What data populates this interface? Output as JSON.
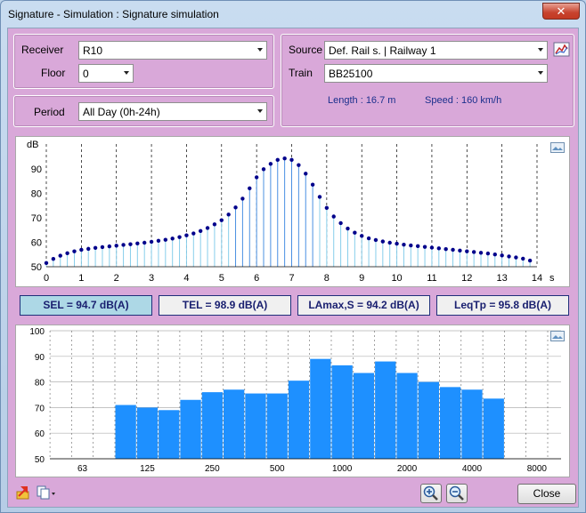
{
  "window": {
    "title": "Signature - Simulation : Signature simulation"
  },
  "receiver": {
    "label": "Receiver",
    "value": "R10"
  },
  "floor": {
    "label": "Floor",
    "value": "0"
  },
  "period": {
    "label": "Period",
    "value": "All Day (0h-24h)"
  },
  "source": {
    "label": "Source",
    "value": "Def. Rail s. | Railway 1"
  },
  "train": {
    "label": "Train",
    "value": "BB25100"
  },
  "length": {
    "text": "Length : 16.7 m"
  },
  "speed": {
    "text": "Speed : 160 km/h"
  },
  "metrics": [
    {
      "text": "SEL = 94.7 dB(A)",
      "active": true
    },
    {
      "text": "TEL = 98.9 dB(A)",
      "active": false
    },
    {
      "text": "LAmax,S = 94.2 dB(A)",
      "active": false
    },
    {
      "text": "LeqTp = 95.8 dB(A)",
      "active": false
    }
  ],
  "buttons": {
    "close": "Close"
  },
  "colors": {
    "bar": "#1e90ff",
    "dot": "#00008b",
    "stem": "#87ceeb",
    "background": "#d9a8d9"
  },
  "chart_data": [
    {
      "type": "line",
      "unit_label": "dB",
      "x_unit_label": "s",
      "xlim": [
        0,
        14
      ],
      "ylim": [
        50,
        95
      ],
      "x_ticks": [
        0,
        1,
        2,
        3,
        4,
        5,
        6,
        7,
        8,
        9,
        10,
        11,
        12,
        13,
        14
      ],
      "x_tick_labels": [
        "0",
        "1",
        "2",
        "3",
        "4",
        "5",
        "6",
        "7",
        "8",
        "9",
        "10",
        "11",
        "12",
        "13",
        "14"
      ],
      "y_ticks": [
        50,
        60,
        70,
        80,
        90
      ],
      "y_tick_labels": [
        "50",
        "60",
        "70",
        "80",
        "90"
      ],
      "grid": true,
      "series": [
        {
          "x": [
            0.0,
            0.2,
            0.4,
            0.6,
            0.8,
            1.0,
            1.2,
            1.4,
            1.6,
            1.8,
            2.0,
            2.2,
            2.4,
            2.6,
            2.8,
            3.0,
            3.2,
            3.4,
            3.6,
            3.8,
            4.0,
            4.2,
            4.4,
            4.6,
            4.8,
            5.0,
            5.2,
            5.4,
            5.6,
            5.8,
            6.0,
            6.2,
            6.4,
            6.6,
            6.8,
            7.0,
            7.2,
            7.4,
            7.6,
            7.8,
            8.0,
            8.2,
            8.4,
            8.6,
            8.8,
            9.0,
            9.2,
            9.4,
            9.6,
            9.8,
            10.0,
            10.2,
            10.4,
            10.6,
            10.8,
            11.0,
            11.2,
            11.4,
            11.6,
            11.8,
            12.0,
            12.2,
            12.4,
            12.6,
            12.8,
            13.0,
            13.2,
            13.4,
            13.6,
            13.8
          ],
          "y": [
            51.5,
            53.2,
            54.5,
            55.5,
            56.3,
            56.9,
            57.3,
            57.7,
            58.0,
            58.3,
            58.6,
            58.9,
            59.2,
            59.5,
            59.8,
            60.2,
            60.6,
            61.0,
            61.5,
            62.1,
            62.8,
            63.6,
            64.6,
            65.8,
            67.3,
            69.0,
            71.3,
            74.2,
            77.8,
            82.0,
            86.5,
            89.8,
            92.0,
            93.6,
            94.2,
            93.6,
            91.5,
            88.0,
            83.5,
            78.5,
            74.0,
            70.5,
            67.8,
            65.6,
            63.9,
            62.6,
            61.6,
            60.9,
            60.3,
            59.8,
            59.4,
            59.0,
            58.7,
            58.4,
            58.1,
            57.8,
            57.5,
            57.2,
            56.9,
            56.6,
            56.3,
            56.0,
            55.7,
            55.4,
            55.0,
            54.6,
            54.2,
            53.8,
            53.3,
            52.5
          ]
        }
      ]
    },
    {
      "type": "bar",
      "ylim": [
        50,
        100
      ],
      "y_ticks": [
        50,
        60,
        70,
        80,
        90,
        100
      ],
      "y_tick_labels": [
        "50",
        "60",
        "70",
        "80",
        "90",
        "100"
      ],
      "x_tick_labels": [
        "63",
        "125",
        "250",
        "500",
        "1000",
        "2000",
        "4000",
        "8000"
      ],
      "grid": true,
      "values": [
        71.0,
        70.0,
        69.0,
        73.0,
        76.0,
        77.0,
        75.5,
        75.5,
        80.5,
        89.0,
        86.5,
        83.5,
        88.0,
        83.5,
        80.0,
        78.0,
        77.0,
        73.5
      ]
    }
  ]
}
